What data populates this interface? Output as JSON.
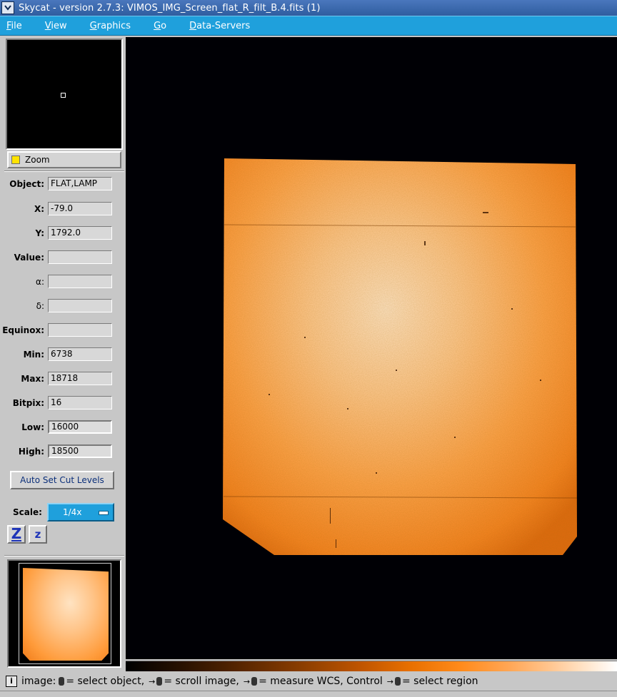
{
  "window": {
    "title": "Skycat - version 2.7.3: VIMOS_IMG_Screen_flat_R_filt_B.4.fits (1)"
  },
  "menu": [
    {
      "label": "File",
      "underline": "F",
      "rest": "ile"
    },
    {
      "label": "View",
      "underline": "V",
      "rest": "iew"
    },
    {
      "label": "Graphics",
      "underline": "G",
      "rest": "raphics"
    },
    {
      "label": "Go",
      "underline": "G",
      "rest": "o"
    },
    {
      "label": "Data-Servers",
      "underline": "D",
      "rest": "ata-Servers"
    }
  ],
  "zoom": {
    "label": "Zoom",
    "indicator_color": "#ffe300"
  },
  "info": {
    "object": {
      "label": "Object:",
      "value": "FLAT,LAMP"
    },
    "x": {
      "label": "X:",
      "value": "-79.0"
    },
    "y": {
      "label": "Y:",
      "value": "1792.0"
    },
    "value": {
      "label": "Value:",
      "value": ""
    },
    "alpha": {
      "label": "α:",
      "value": ""
    },
    "delta": {
      "label": "δ:",
      "value": ""
    },
    "equinox": {
      "label": "Equinox:",
      "value": ""
    },
    "min": {
      "label": "Min:",
      "value": "6738"
    },
    "max": {
      "label": "Max:",
      "value": "18718"
    },
    "bitpix": {
      "label": "Bitpix:",
      "value": "16"
    },
    "low": {
      "label": "Low:",
      "value": "16000"
    },
    "high": {
      "label": "High:",
      "value": "18500"
    }
  },
  "controls": {
    "autoset_label": "Auto Set Cut Levels",
    "scale_label": "Scale:",
    "scale_value": "1/4x",
    "zoom_in_label": "Z",
    "zoom_out_label": "z"
  },
  "status": {
    "icon": "i",
    "prefix": "image:",
    "select_object": "= select object,",
    "scroll_image": "= scroll image,",
    "measure_wcs": "= measure WCS, Control",
    "select_region": "= select region"
  },
  "colors": {
    "menubar": "#1fa0dc",
    "titlebar": "#2f5d9f",
    "image_orange": "#ff9b3a",
    "panel": "#c7c7c7"
  }
}
